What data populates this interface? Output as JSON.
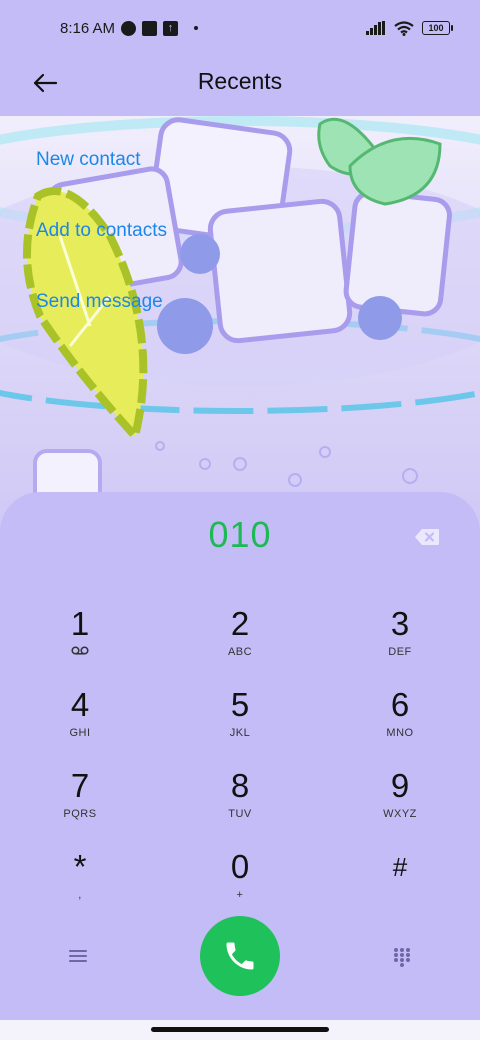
{
  "status_bar": {
    "time": "8:16 AM",
    "battery": "100",
    "icons": [
      "app-notification-icon",
      "square-notification-icon",
      "upload-icon",
      "dot-icon",
      "signal-icon",
      "wifi-icon",
      "battery-icon"
    ]
  },
  "header": {
    "title": "Recents",
    "back_icon": "arrow-left-icon"
  },
  "actions": {
    "new_contact": "New contact",
    "add_to_contacts": "Add to contacts",
    "send_message": "Send message"
  },
  "dialpad": {
    "number": "010",
    "backspace_icon": "backspace-icon",
    "keys": [
      {
        "digit": "1",
        "letters": ""
      },
      {
        "digit": "2",
        "letters": "ABC"
      },
      {
        "digit": "3",
        "letters": "DEF"
      },
      {
        "digit": "4",
        "letters": "GHI"
      },
      {
        "digit": "5",
        "letters": "JKL"
      },
      {
        "digit": "6",
        "letters": "MNO"
      },
      {
        "digit": "7",
        "letters": "PQRS"
      },
      {
        "digit": "8",
        "letters": "TUV"
      },
      {
        "digit": "9",
        "letters": "WXYZ"
      },
      {
        "digit": "*",
        "letters": ","
      },
      {
        "digit": "0",
        "letters": "+"
      },
      {
        "digit": "#",
        "letters": ""
      }
    ],
    "voicemail_icon": "voicemail-icon",
    "menu_icon": "menu-icon",
    "call_icon": "phone-icon",
    "keypad_icon": "dialpad-icon"
  },
  "colors": {
    "accent_link": "#1b87e8",
    "number_green": "#1db954",
    "call_button": "#1ec15a",
    "panel": "#c4bcf6"
  }
}
